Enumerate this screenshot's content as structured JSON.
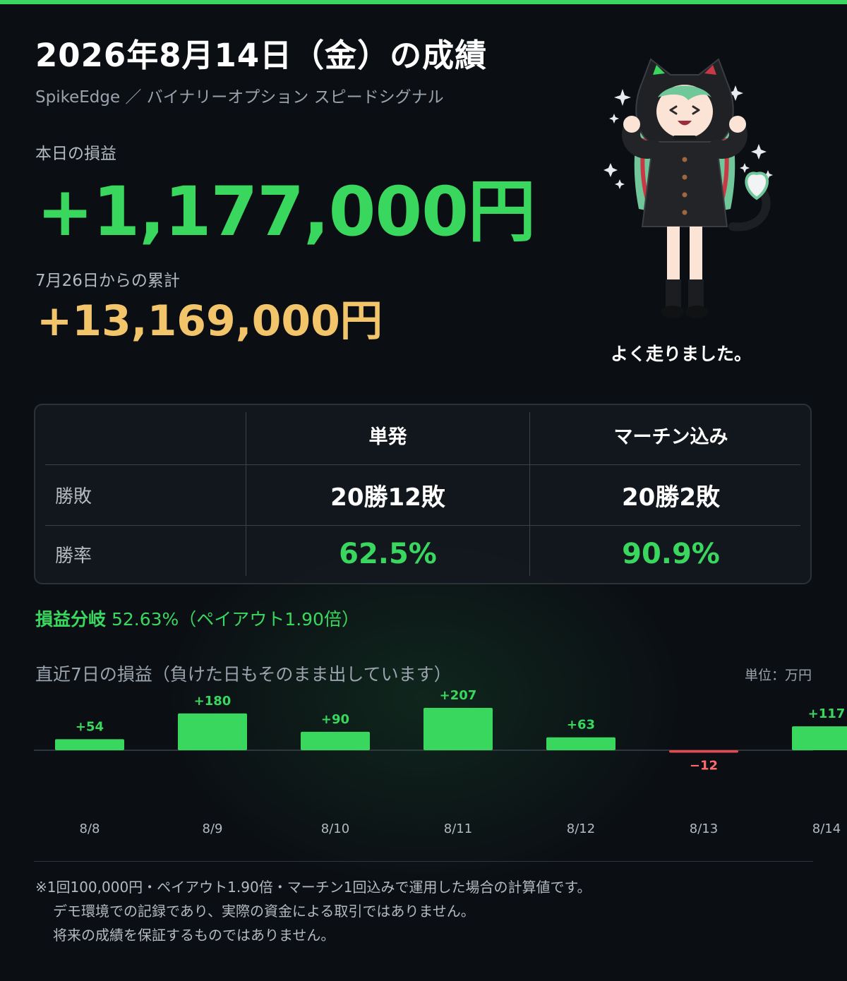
{
  "header": {
    "title": "2026年8月14日（金）の成績",
    "subtitle": "SpikeEdge ／ バイナリーオプション スピードシグナル"
  },
  "today": {
    "label": "本日の損益",
    "value": "+1,177,000円"
  },
  "cumulative": {
    "label": "7月26日からの累計",
    "value": "+13,169,000円"
  },
  "mascot": {
    "icon": "cat-hood-girl-illustration",
    "caption": "よく走りました。"
  },
  "stats": {
    "columns": [
      "単発",
      "マーチン込み"
    ],
    "rows": [
      {
        "label": "勝敗",
        "values": [
          "20勝12敗",
          "20勝2敗"
        ]
      },
      {
        "label": "勝率",
        "values": [
          "62.5%",
          "90.9%"
        ]
      }
    ]
  },
  "breakeven": {
    "label": "損益分岐",
    "value": "52.63%（ペイアウト1.90倍）"
  },
  "chart_title": "直近7日の損益（負けた日もそのまま出しています）",
  "unit": "単位：万円",
  "chart_data": {
    "type": "bar",
    "title": "直近7日の損益（負けた日もそのまま出しています）",
    "categories": [
      "8/8",
      "8/9",
      "8/10",
      "8/11",
      "8/12",
      "8/13",
      "8/14"
    ],
    "values": [
      54,
      180,
      90,
      207,
      63,
      -12,
      117
    ],
    "value_labels": [
      "+54",
      "+180",
      "+90",
      "+207",
      "+63",
      "−12",
      "+117"
    ],
    "unit": "万円",
    "positive_color": "#3ad75f",
    "negative_color": "#e5484d",
    "grid": false,
    "legend": false
  },
  "notes": [
    "※1回100,000円・ペイアウト1.90倍・マーチン1回込みで運用した場合の計算値です。",
    "デモ環境での記録であり、実際の資金による取引ではありません。",
    "将来の成績を保証するものではありません。"
  ],
  "colors": {
    "accent_green": "#3ad75f",
    "accent_gold": "#f3c56b",
    "background": "#0b0f14"
  }
}
